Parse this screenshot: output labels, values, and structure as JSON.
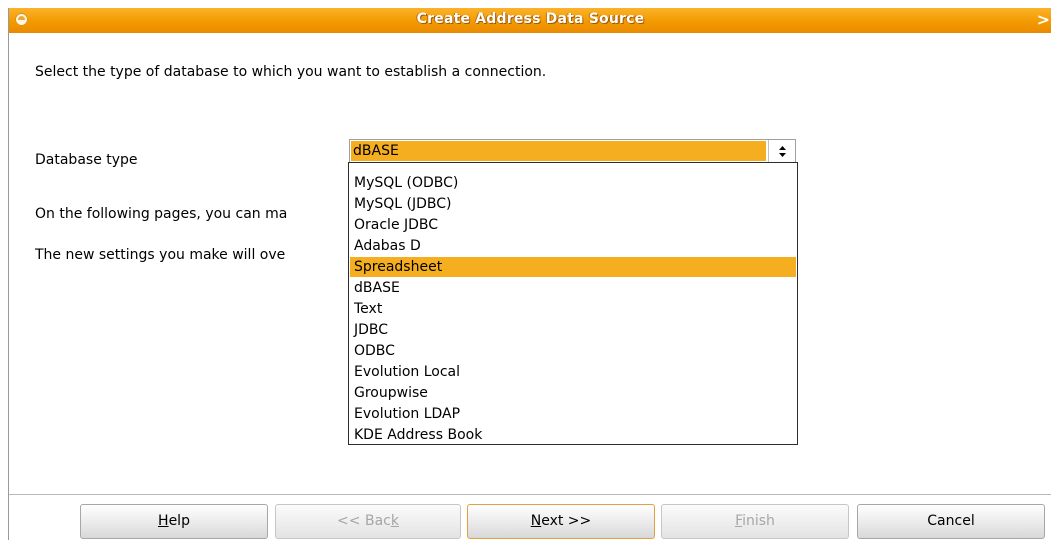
{
  "window": {
    "title": "Create Address Data Source",
    "close_glyph": ">"
  },
  "intro_text": "Select the type of database to which you want to establish a connection.",
  "database_type": {
    "label": "Database type",
    "selected_value": "dBASE",
    "options": [
      "MySQL (ODBC)",
      "MySQL (JDBC)",
      "Oracle JDBC",
      "Adabas D",
      "Spreadsheet",
      "dBASE",
      "Text",
      "JDBC",
      "ODBC",
      "Evolution Local",
      "Groupwise",
      "Evolution LDAP",
      "KDE Address Book"
    ],
    "highlighted_option": "Spreadsheet"
  },
  "paragraph_1": "On the following pages, you can ma",
  "paragraph_2": "The new settings you make will ove",
  "buttons": {
    "help": {
      "label_pre": "",
      "mnemonic": "H",
      "label_post": "elp"
    },
    "back": {
      "label_pre": "<< Bac",
      "mnemonic": "k",
      "label_post": ""
    },
    "next": {
      "label_pre": "",
      "mnemonic": "N",
      "label_post": "ext >>"
    },
    "finish": {
      "label_pre": "",
      "mnemonic": "F",
      "label_post": "inish"
    },
    "cancel": {
      "label": "Cancel"
    }
  },
  "colors": {
    "accent": "#f5ae1f",
    "title_bar": "#f39a00"
  }
}
